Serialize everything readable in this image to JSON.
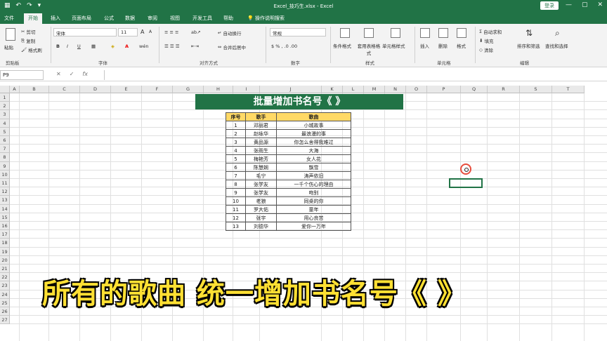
{
  "window": {
    "title": "Excel_技巧生.xlsx - Excel",
    "login_label": "登录",
    "qat": [
      "▦",
      "↶",
      "↷",
      "▾"
    ],
    "win_buttons": [
      "▭",
      "—",
      "▢",
      "✕"
    ]
  },
  "tabs": [
    {
      "label": "文件"
    },
    {
      "label": "开始"
    },
    {
      "label": "插入"
    },
    {
      "label": "页面布局"
    },
    {
      "label": "公式"
    },
    {
      "label": "数据"
    },
    {
      "label": "审阅"
    },
    {
      "label": "视图"
    },
    {
      "label": "开发工具"
    },
    {
      "label": "帮助"
    },
    {
      "label": "操作说明搜索"
    }
  ],
  "ribbon": {
    "clipboard": {
      "paste": "粘贴",
      "cut": "剪切",
      "copy": "复制",
      "format_painter": "格式刷",
      "group": "剪贴板"
    },
    "font": {
      "name": "宋体",
      "size": "11",
      "bold": "B",
      "italic": "I",
      "underline": "U",
      "grow": "A",
      "shrink": "A",
      "wen": "wén",
      "group": "字体"
    },
    "alignment": {
      "wrap": "自动换行",
      "merge": "合并后居中",
      "group": "对齐方式"
    },
    "number": {
      "format": "常规",
      "group": "数字"
    },
    "styles": {
      "conditional": "条件格式",
      "table": "套用表格格式",
      "cell": "单元格样式",
      "group": "样式"
    },
    "cells": {
      "insert": "插入",
      "delete": "删除",
      "format": "格式",
      "group": "单元格"
    },
    "editing": {
      "autosum": "自动求和",
      "fill": "填充",
      "clear": "清除",
      "sort": "排序和筛选",
      "find": "查找和选择",
      "group": "编辑"
    }
  },
  "formula_bar": {
    "name_box": "P9",
    "icons": [
      "✕",
      "✓",
      "fx"
    ]
  },
  "columns": [
    "A",
    "B",
    "C",
    "D",
    "E",
    "F",
    "G",
    "H",
    "I",
    "J",
    "K",
    "L",
    "M",
    "N",
    "O",
    "P",
    "Q",
    "R",
    "S",
    "T"
  ],
  "rows": [
    "1",
    "2",
    "3",
    "4",
    "5",
    "6",
    "7",
    "8",
    "9",
    "10",
    "11",
    "12",
    "13",
    "14",
    "15",
    "16",
    "17",
    "18",
    "19",
    "20",
    "21",
    "22",
    "23",
    "24",
    "25",
    "26",
    "27"
  ],
  "banner": "批量增加书名号《 》",
  "table": {
    "headers": [
      "序号",
      "歌手",
      "歌曲"
    ],
    "rows": [
      [
        "1",
        "邓丽君",
        "小城故事"
      ],
      [
        "2",
        "赵咏华",
        "最浪漫的事"
      ],
      [
        "3",
        "黄品源",
        "你怎么舍得我难过"
      ],
      [
        "4",
        "张雨生",
        "大海"
      ],
      [
        "5",
        "梅艳芳",
        "女人花"
      ],
      [
        "6",
        "陈慧娴",
        "飘雪"
      ],
      [
        "7",
        "毛宁",
        "涛声依旧"
      ],
      [
        "8",
        "张学友",
        "一千个伤心的理由"
      ],
      [
        "9",
        "张学友",
        "吻别"
      ],
      [
        "10",
        "老狼",
        "同桌的你"
      ],
      [
        "11",
        "罗大佑",
        "童年"
      ],
      [
        "12",
        "张宇",
        "用心良苦"
      ],
      [
        "13",
        "刘德华",
        "爱你一万年"
      ]
    ]
  },
  "caption": "所有的歌曲 统一增加书名号《 》"
}
